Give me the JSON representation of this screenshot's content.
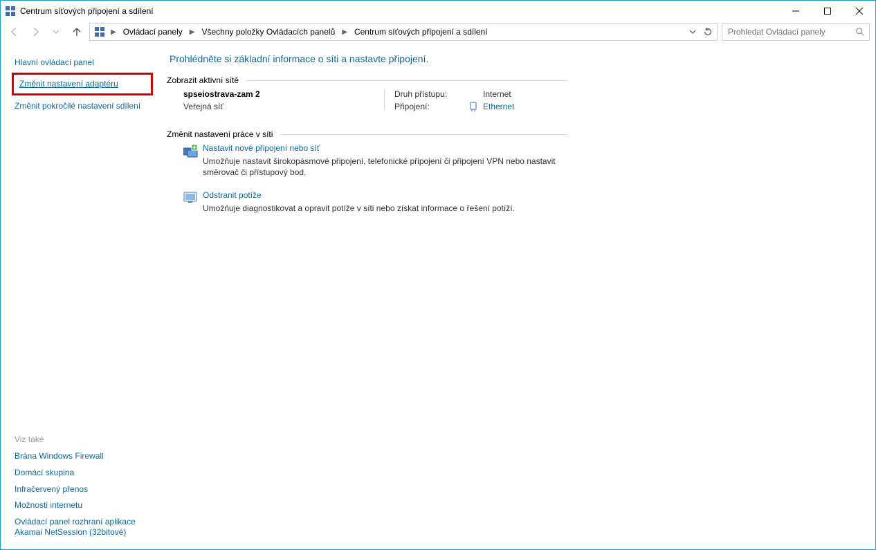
{
  "window_title": "Centrum síťových připojení a sdílení",
  "breadcrumb": {
    "items": [
      "Ovládací panely",
      "Všechny položky Ovládacích panelů",
      "Centrum síťových připojení a sdílení"
    ]
  },
  "search": {
    "placeholder": "Prohledat Ovládací panely"
  },
  "sidebar": {
    "home": "Hlavní ovládací panel",
    "change_adapter": "Změnit nastavení adaptéru",
    "advanced_sharing": "Změnit pokročilé nastavení sdílení",
    "see_also_title": "Viz také",
    "see_also": [
      "Brána Windows Firewall",
      "Domácí skupina",
      "Infračervený přenos",
      "Možnosti internetu",
      "Ovládací panel rozhraní aplikace Akamai NetSession (32bitové)"
    ]
  },
  "main": {
    "heading": "Prohlédněte si základní informace o síti a nastavte připojení.",
    "section_active": "Zobrazit aktivní sítě",
    "network": {
      "name": "spseiostrava-zam  2",
      "type": "Veřejná síť",
      "access_lbl": "Druh přístupu:",
      "access_val": "Internet",
      "conn_lbl": "Připojení:",
      "conn_val": "Ethernet"
    },
    "section_settings": "Změnit nastavení práce v síti",
    "task1": {
      "title": "Nastavit nové připojení nebo síť",
      "desc": "Umožňuje nastavit širokopásmové připojení, telefonické připojení či připojení VPN nebo nastavit směrovač či přístupový bod."
    },
    "task2": {
      "title": "Odstranit potíže",
      "desc": "Umožňuje diagnostikovat a opravit potíže v síti nebo získat informace o řešení potíží."
    }
  }
}
